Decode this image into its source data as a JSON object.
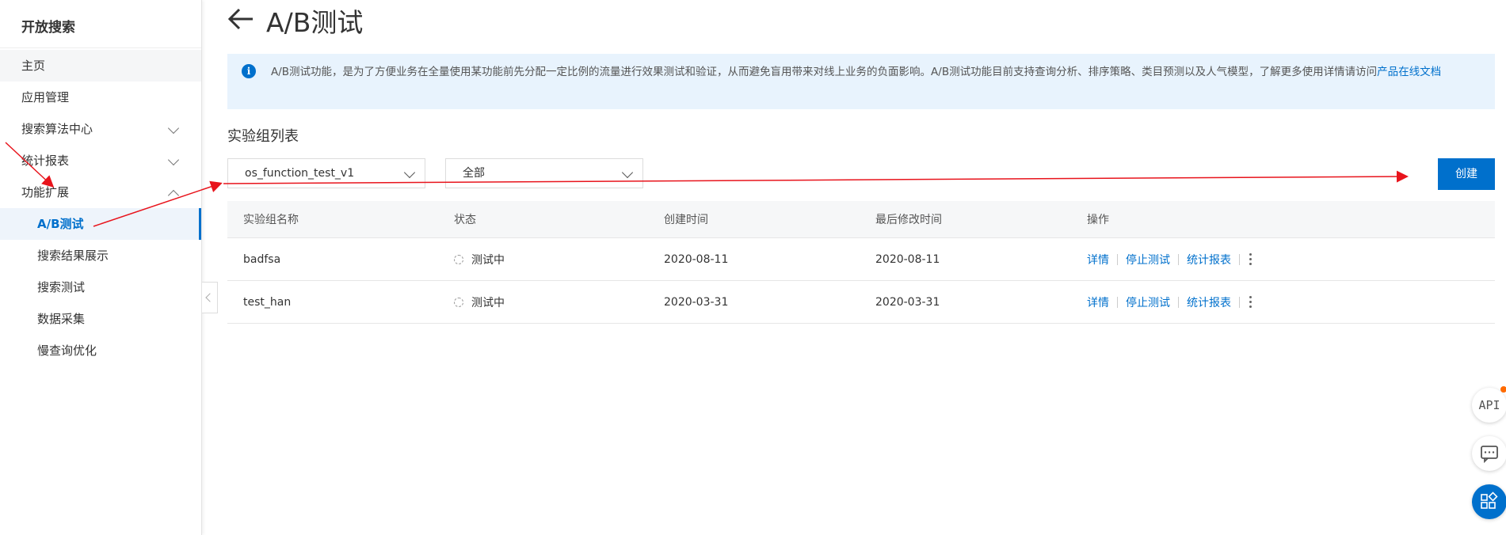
{
  "sidebar": {
    "title": "开放搜索",
    "items": [
      {
        "label": "主页"
      },
      {
        "label": "应用管理"
      },
      {
        "label": "搜索算法中心"
      },
      {
        "label": "统计报表"
      },
      {
        "label": "功能扩展"
      },
      {
        "label": "A/B测试"
      },
      {
        "label": "搜索结果展示"
      },
      {
        "label": "搜索测试"
      },
      {
        "label": "数据采集"
      },
      {
        "label": "慢查询优化"
      }
    ]
  },
  "header": {
    "title": "A/B测试"
  },
  "info": {
    "text": "A/B测试功能，是为了方便业务在全量使用某功能前先分配一定比例的流量进行效果测试和验证，从而避免盲用带来对线上业务的负面影响。A/B测试功能目前支持查询分析、排序策略、类目预测以及人气模型，了解更多使用详情请访问",
    "link": "产品在线文档"
  },
  "section": {
    "title": "实验组列表"
  },
  "filters": {
    "app_select": "os_function_test_v1",
    "status_select": "全部"
  },
  "create_label": "创建",
  "table": {
    "headers": [
      "实验组名称",
      "状态",
      "创建时间",
      "最后修改时间",
      "操作"
    ],
    "rows": [
      {
        "name": "badfsa",
        "status": "测试中",
        "created": "2020-08-11",
        "modified": "2020-08-11"
      },
      {
        "name": "test_han",
        "status": "测试中",
        "created": "2020-03-31",
        "modified": "2020-03-31"
      }
    ],
    "actions": [
      "详情",
      "停止测试",
      "统计报表"
    ]
  },
  "floating": {
    "api_label": "API"
  },
  "colors": {
    "accent": "#0070cc",
    "info_bg": "#e8f3fd",
    "annotation": "#e8141c"
  }
}
